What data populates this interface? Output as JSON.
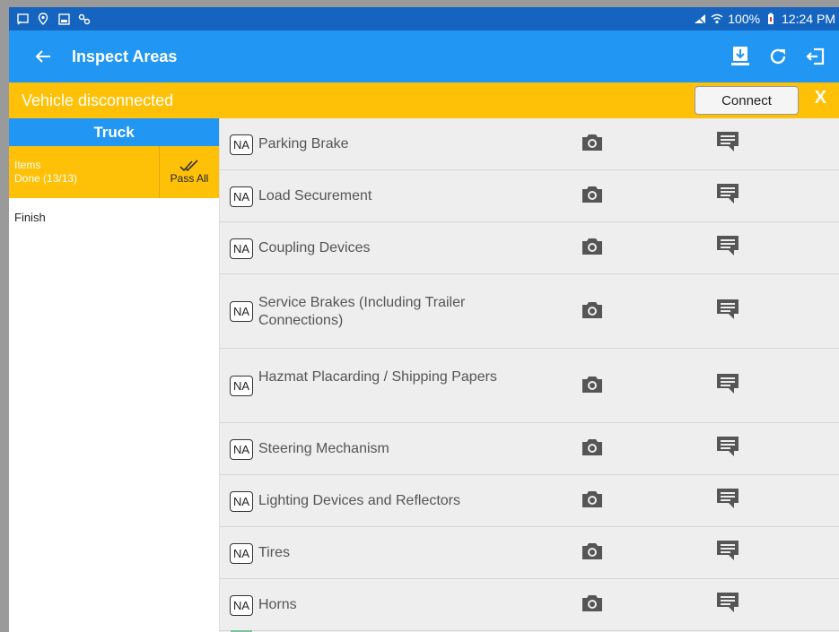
{
  "status_bar": {
    "battery": "100%",
    "time": "12:24 PM"
  },
  "app_bar": {
    "title": "Inspect Areas",
    "back_icon": "arrow-left-icon",
    "actions": [
      "download-report-icon",
      "refresh-icon",
      "logout-icon"
    ]
  },
  "banner": {
    "message": "Vehicle disconnected",
    "connect_label": "Connect",
    "close_label": "X"
  },
  "left_panel": {
    "header": "Truck",
    "items_label": "Items",
    "items_status": "Done (13/13)",
    "pass_all_label": "Pass All",
    "finish_label": "Finish"
  },
  "inspection_items": [
    {
      "na": "NA",
      "label": "Parking Brake"
    },
    {
      "na": "NA",
      "label": "Load Securement"
    },
    {
      "na": "NA",
      "label": "Coupling Devices"
    },
    {
      "na": "NA",
      "label": "Service Brakes (Including Trailer Connections)"
    },
    {
      "na": "NA",
      "label": "Hazmat Placarding / Shipping Papers"
    },
    {
      "na": "NA",
      "label": "Steering Mechanism"
    },
    {
      "na": "NA",
      "label": "Lighting Devices and Reflectors"
    },
    {
      "na": "NA",
      "label": "Tires"
    },
    {
      "na": "NA",
      "label": "Horns"
    }
  ],
  "colors": {
    "status_bar": "#1565c0",
    "app_bar": "#2196f3",
    "banner": "#ffc107",
    "list_bg": "#eeeeee",
    "icon_gray": "#555555"
  }
}
